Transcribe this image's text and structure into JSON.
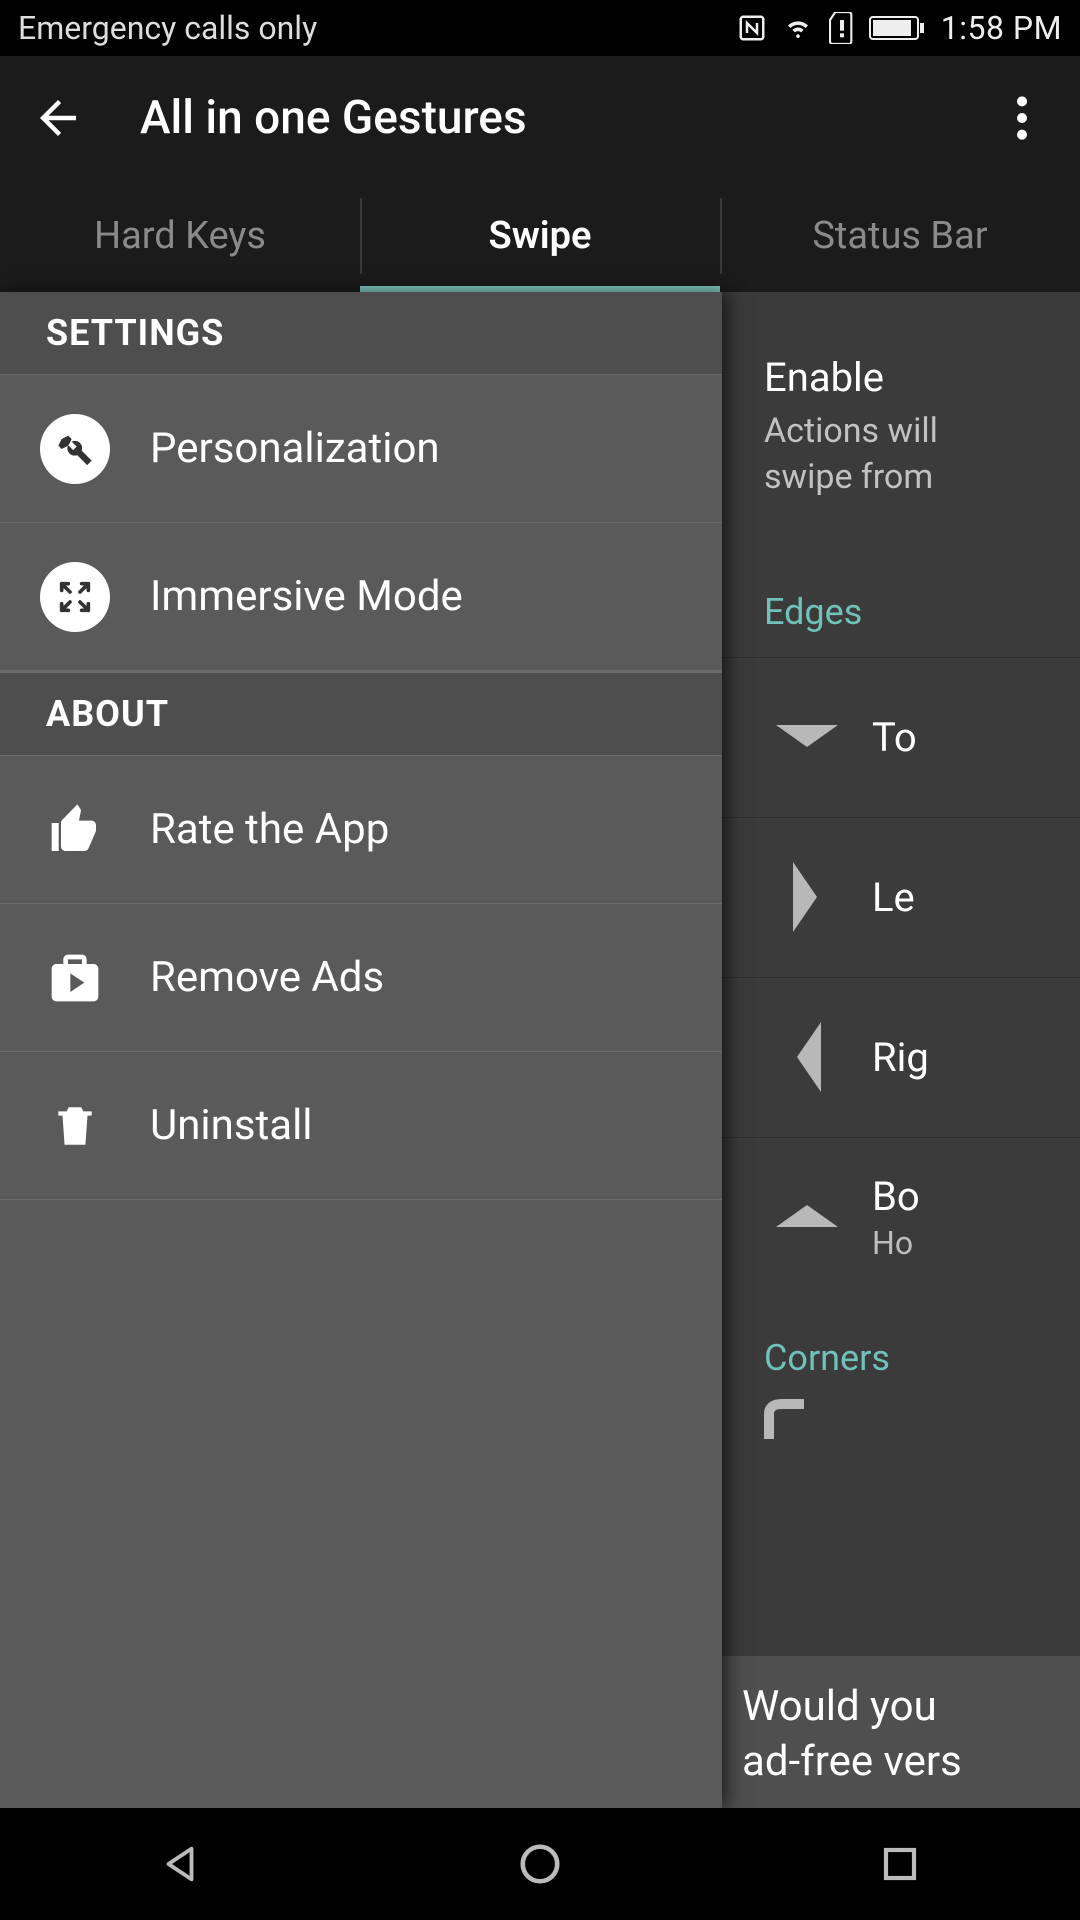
{
  "status": {
    "network_text": "Emergency calls only",
    "time": "1:58 PM"
  },
  "appbar": {
    "title": "All in one Gestures"
  },
  "tabs": [
    {
      "label": "Hard Keys",
      "active": false
    },
    {
      "label": "Swipe",
      "active": true
    },
    {
      "label": "Status Bar",
      "active": false
    }
  ],
  "drawer": {
    "settings_header": "SETTINGS",
    "about_header": "ABOUT",
    "items": {
      "personalization": "Personalization",
      "immersive": "Immersive Mode",
      "rate": "Rate the App",
      "remove_ads": "Remove Ads",
      "uninstall": "Uninstall"
    }
  },
  "page": {
    "enable_title": "Enable",
    "enable_sub_line1": "Actions will",
    "enable_sub_line2": "swipe from",
    "edges_header": "Edges",
    "top_label": "To",
    "left_label": "Le",
    "right_label": "Rig",
    "bottom_label": "Bo",
    "bottom_sub": "Ho",
    "corners_header": "Corners",
    "adfree_line1": "Would you",
    "adfree_line2": "ad-free vers"
  },
  "colors": {
    "accent": "#80cbc4"
  }
}
